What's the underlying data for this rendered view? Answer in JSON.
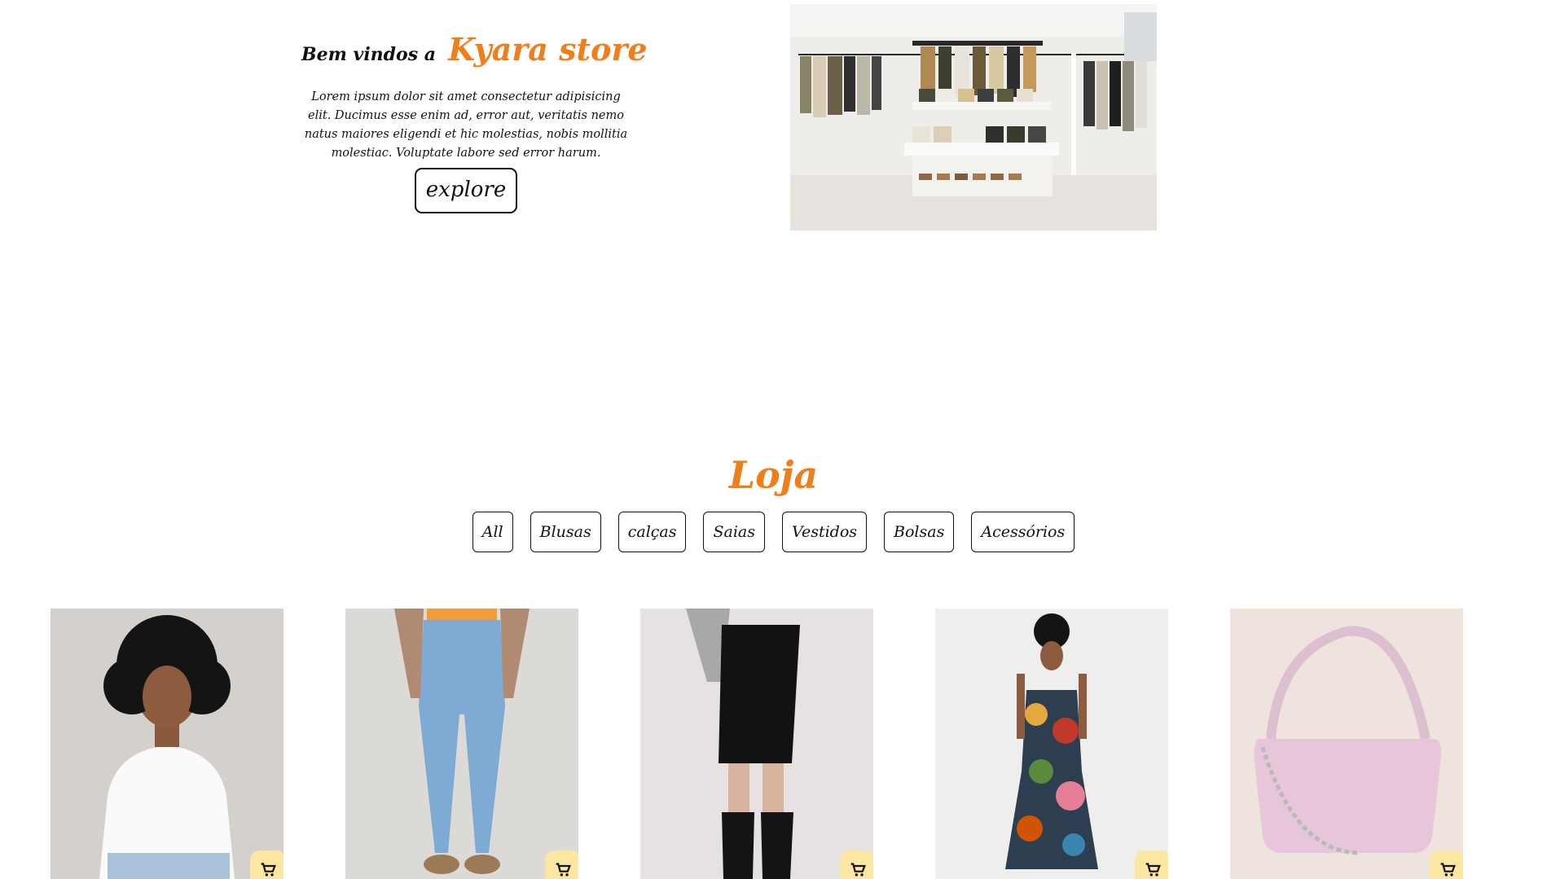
{
  "hero": {
    "welcome": "Bem vindos a",
    "brand": "Kyara store",
    "description": "Lorem ipsum dolor sit amet consectetur adipisicing elit. Ducimus esse enim ad, error aut, veritatis nemo natus maiores eligendi et hic molestias, nobis mollitia molestiac. Voluptate labore sed error harum.",
    "explore_label": "explore",
    "image": "clothing-store-interior"
  },
  "shop": {
    "title": "Loja",
    "filters": [
      "All",
      "Blusas",
      "calças",
      "Saias",
      "Vestidos",
      "Bolsas",
      "Acessórios"
    ],
    "products": [
      {
        "image": "woman-white-tshirt"
      },
      {
        "image": "light-blue-jeans"
      },
      {
        "image": "black-pencil-skirt"
      },
      {
        "image": "floral-dress"
      },
      {
        "image": "pink-shoulder-bag"
      }
    ]
  },
  "colors": {
    "accent": "#ef7f1a",
    "cart_button": "#fbe7a1",
    "text": "#111111",
    "background": "#ffffff"
  }
}
